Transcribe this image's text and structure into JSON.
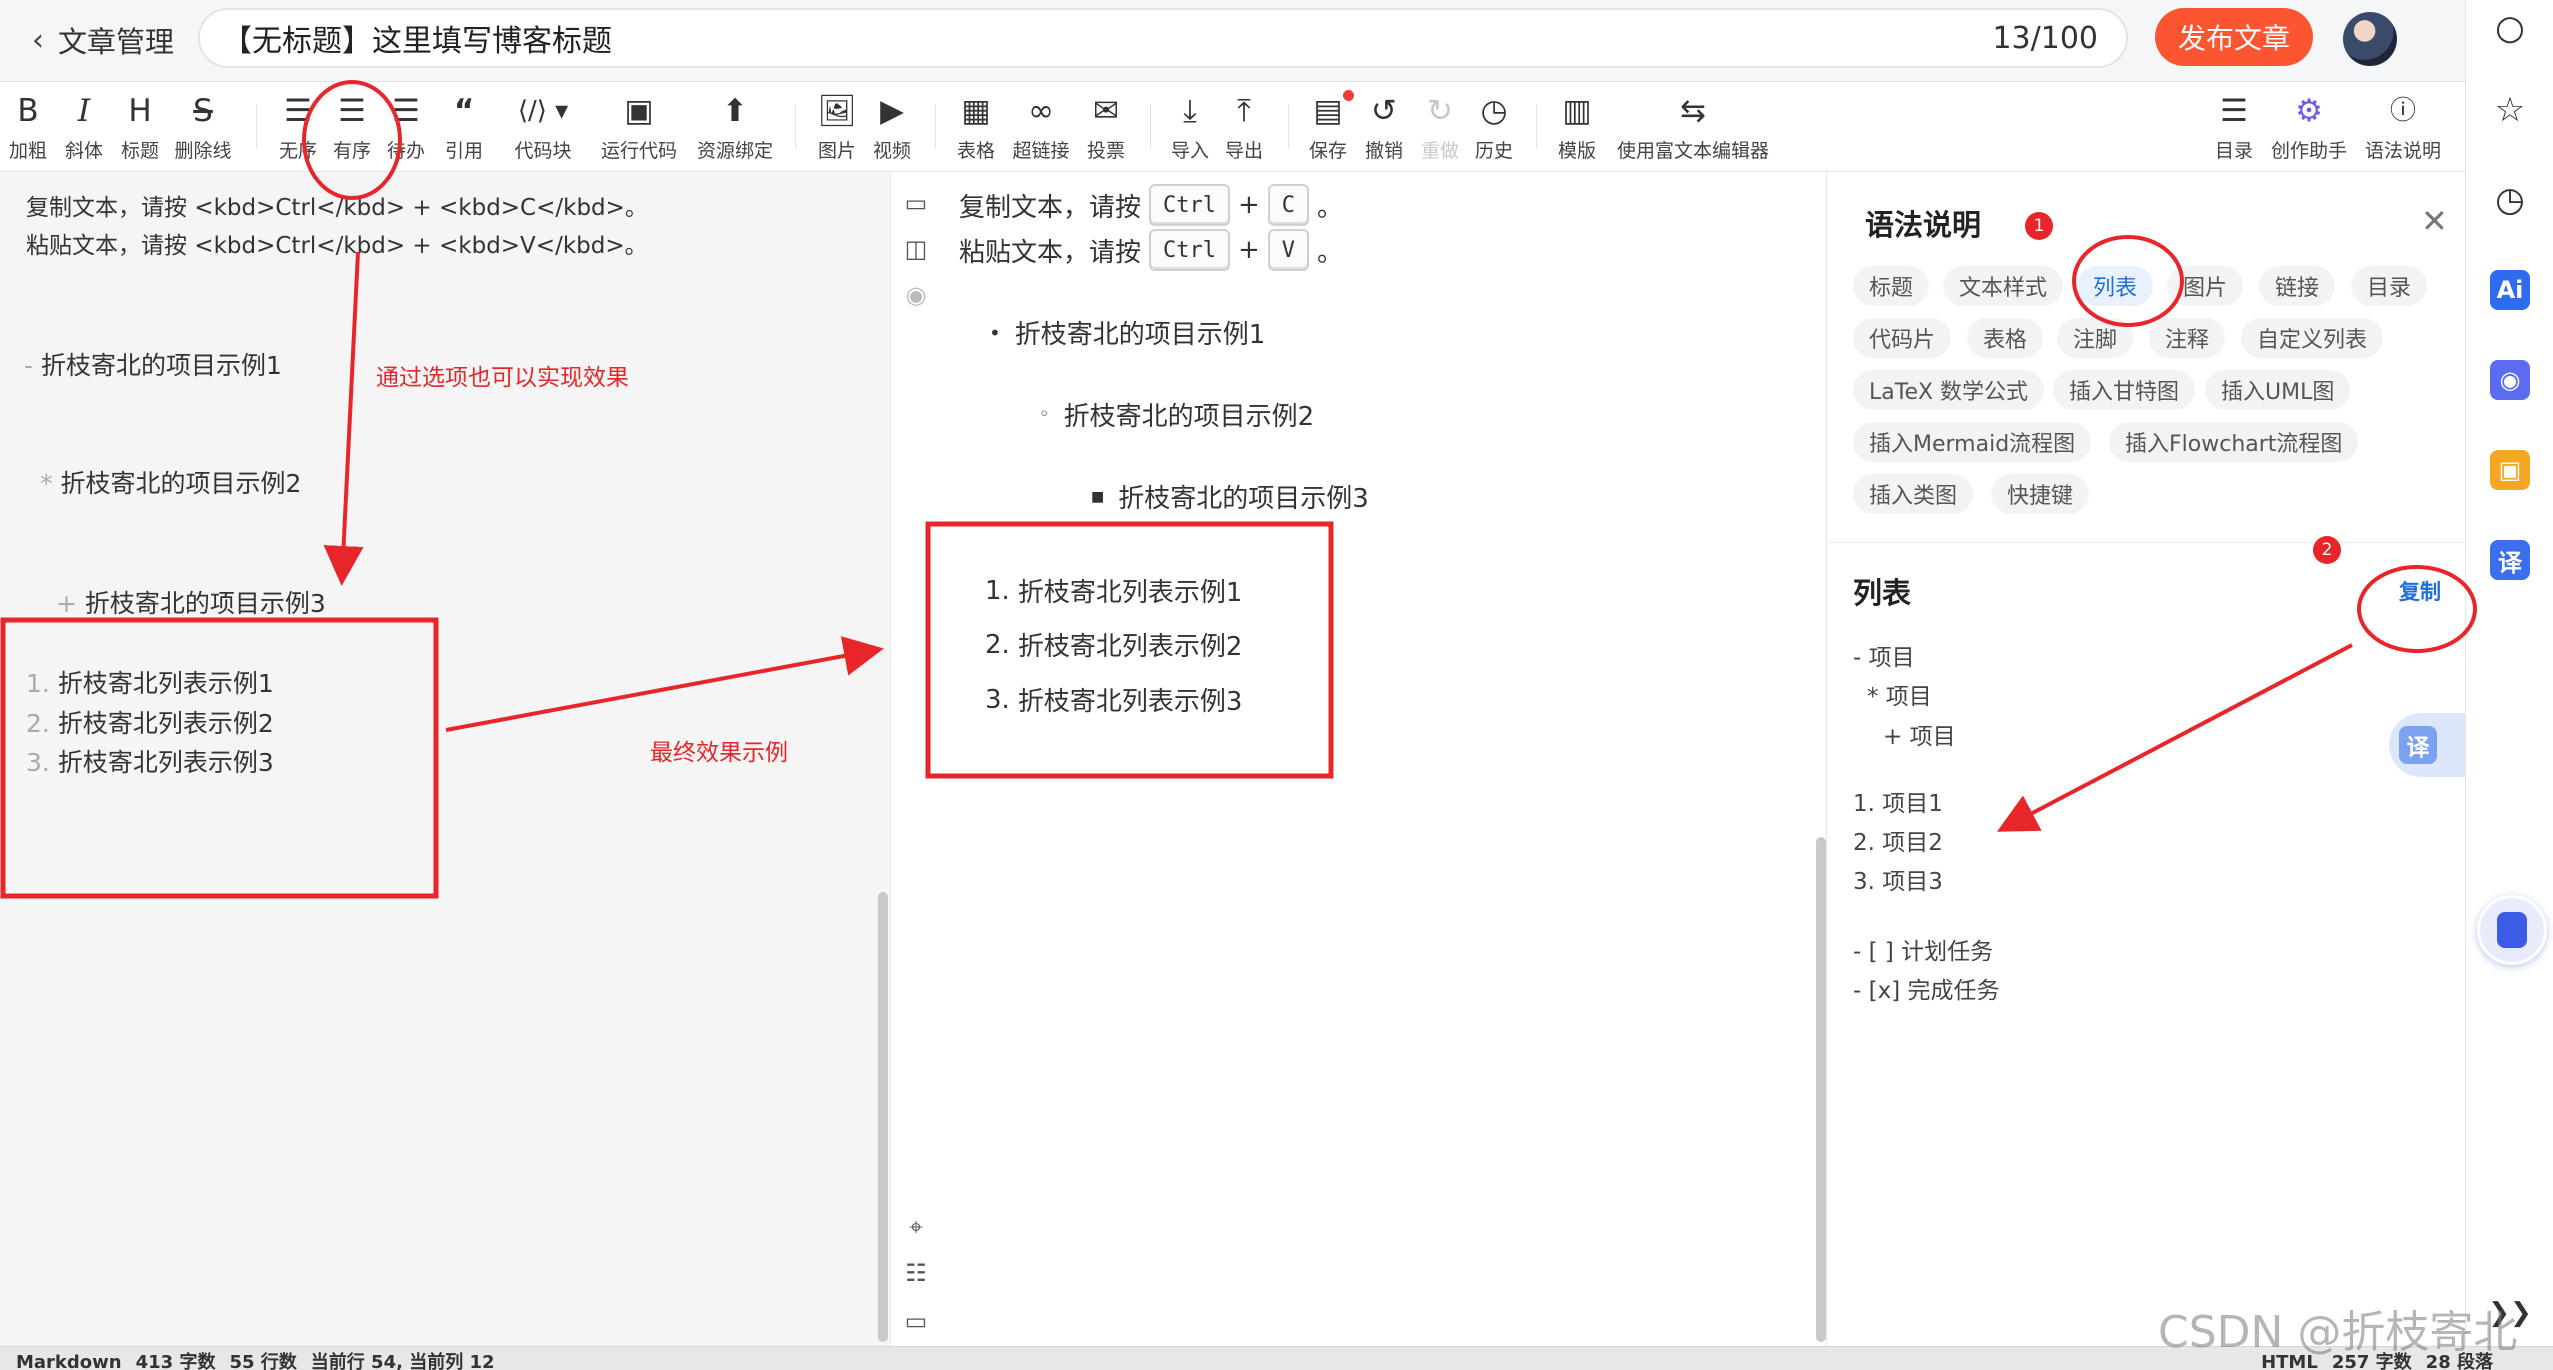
{
  "header": {
    "back_label": "文章管理",
    "title_value": "【无标题】这里填写博客标题",
    "title_count": "13/100",
    "publish_label": "发布文章"
  },
  "toolbar": {
    "bold": "加粗",
    "italic": "斜体",
    "heading": "标题",
    "strike": "删除线",
    "unordered": "无序",
    "ordered": "有序",
    "todo": "待办",
    "quote": "引用",
    "codeblock": "代码块",
    "run_code": "运行代码",
    "resource": "资源绑定",
    "image": "图片",
    "video": "视频",
    "table": "表格",
    "link": "超链接",
    "vote": "投票",
    "import": "导入",
    "export": "导出",
    "save": "保存",
    "undo": "撤销",
    "redo": "重做",
    "history": "历史",
    "template": "模版",
    "rich_text": "使用富文本编辑器",
    "toc": "目录",
    "assistant": "创作助手",
    "syntax_help": "语法说明",
    "glyph_bold": "B",
    "glyph_italic": "I",
    "glyph_heading": "H",
    "glyph_strike": "S"
  },
  "editor": {
    "line1": "复制文本，请按 <kbd>Ctrl</kbd> + <kbd>C</kbd>。",
    "line2": "粘贴文本，请按 <kbd>Ctrl</kbd> + <kbd>V</kbd>。",
    "bullet1_marker": "-",
    "bullet1": "折枝寄北的项目示例1",
    "bullet2_marker": "*",
    "bullet2": "折枝寄北的项目示例2",
    "bullet3_marker": "+",
    "bullet3": "折枝寄北的项目示例3",
    "ordered": [
      {
        "num": "1.",
        "text": "折枝寄北列表示例1"
      },
      {
        "num": "2.",
        "text": "折枝寄北列表示例2"
      },
      {
        "num": "3.",
        "text": "折枝寄北列表示例3"
      }
    ]
  },
  "preview": {
    "copy_prefix": "复制文本，请按",
    "key_ctrl": "Ctrl",
    "plus": "+",
    "key_c": "C",
    "period": "。",
    "paste_prefix": "粘贴文本，请按",
    "key_v": "V",
    "bullet1": "折枝寄北的项目示例1",
    "bullet2": "折枝寄北的项目示例2",
    "bullet3": "折枝寄北的项目示例3",
    "ordered": [
      {
        "num": "1.",
        "text": "折枝寄北列表示例1"
      },
      {
        "num": "2.",
        "text": "折枝寄北列表示例2"
      },
      {
        "num": "3.",
        "text": "折枝寄北列表示例3"
      }
    ]
  },
  "help": {
    "title": "语法说明",
    "tags": [
      "标题",
      "文本样式",
      "列表",
      "图片",
      "链接",
      "目录",
      "代码片",
      "表格",
      "注脚",
      "注释",
      "自定义列表",
      "LaTeX 数学公式",
      "插入甘特图",
      "插入UML图",
      "插入Mermaid流程图",
      "插入Flowchart流程图",
      "插入类图",
      "快捷键"
    ],
    "active_tag": "列表",
    "section_title": "列表",
    "copy_label": "复制",
    "code": [
      "- 项目",
      "* 项目",
      "+ 项目",
      "1. 项目1",
      "2. 项目2",
      "3. 项目3",
      "- [ ] 计划任务",
      "- [x] 完成任务"
    ]
  },
  "sidebar": {
    "ai_label": "Ai",
    "translate_label": "译"
  },
  "status": {
    "mode": "Markdown",
    "chars": "413 字数",
    "lines": "55 行数",
    "cursor": "当前行 54, 当前列 12",
    "right_mode": "HTML",
    "right_chars": "257 字数",
    "paragraphs": "28 段落"
  },
  "annotations": {
    "options_note": "通过选项也可以实现效果",
    "final_note": "最终效果示例",
    "badge1": "1",
    "badge2": "2"
  },
  "watermark": "CSDN @折枝寄北",
  "colors": {
    "publish": "#fc5531",
    "annotation": "#e8262a",
    "link": "#1e6fd9"
  }
}
